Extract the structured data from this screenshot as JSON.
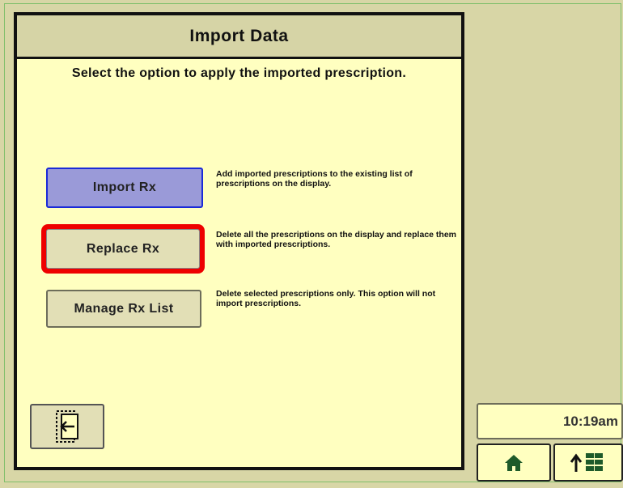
{
  "dialog": {
    "title": "Import Data",
    "instruction": "Select the option to apply the imported prescription."
  },
  "options": [
    {
      "label": "Import Rx",
      "description": "Add imported prescriptions to the existing list of prescriptions on the display."
    },
    {
      "label": "Replace Rx",
      "description": "Delete all the prescriptions on the display and replace them with imported prescriptions."
    },
    {
      "label": "Manage Rx List",
      "description": "Delete selected prescriptions only.  This option will not import prescriptions."
    }
  ],
  "status": {
    "time": "10:19am"
  },
  "colors": {
    "background": "#d8d6a6",
    "panel": "#ffffc0",
    "selected_button": "#9a9ad8",
    "highlight": "#ee0000",
    "icon_green": "#1e5a2a"
  },
  "icons": [
    "exit-back-icon",
    "home-icon",
    "layout-manager-icon"
  ]
}
